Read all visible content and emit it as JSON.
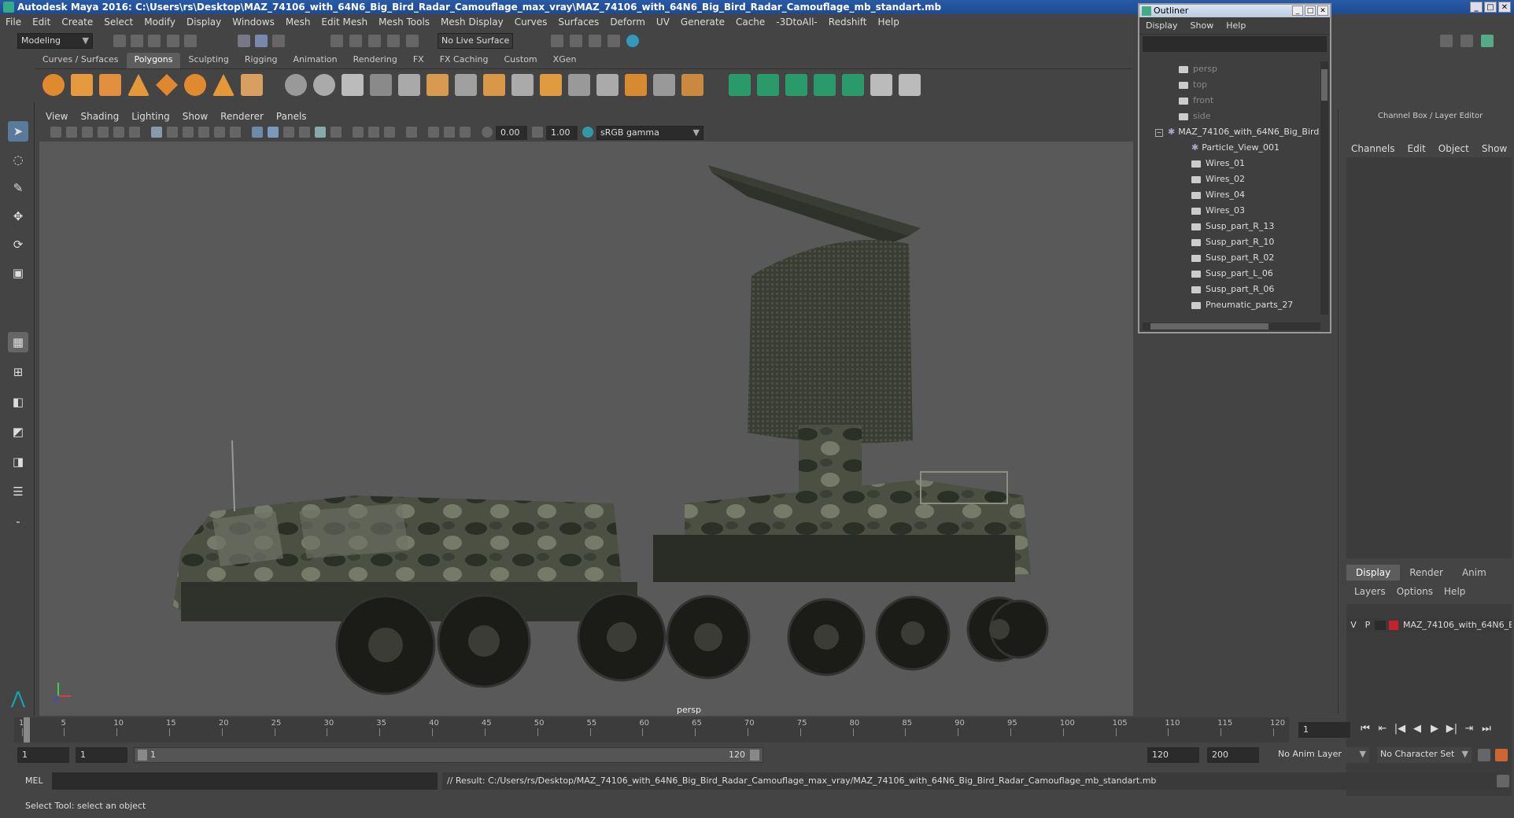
{
  "window": {
    "title": "Autodesk Maya 2016: C:\\Users\\rs\\Desktop\\MAZ_74106_with_64N6_Big_Bird_Radar_Camouflage_max_vray\\MAZ_74106_with_64N6_Big_Bird_Radar_Camouflage_mb_standart.mb"
  },
  "menubar": [
    "File",
    "Edit",
    "Create",
    "Select",
    "Modify",
    "Display",
    "Windows",
    "Mesh",
    "Edit Mesh",
    "Mesh Tools",
    "Mesh Display",
    "Curves",
    "Surfaces",
    "Deform",
    "UV",
    "Generate",
    "Cache",
    "-3DtoAll-",
    "Redshift",
    "Help"
  ],
  "statusline": {
    "mode": "Modeling",
    "live_surface": "No Live Surface"
  },
  "shelf_tabs": [
    "Curves / Surfaces",
    "Polygons",
    "Sculpting",
    "Rigging",
    "Animation",
    "Rendering",
    "FX",
    "FX Caching",
    "Custom",
    "XGen"
  ],
  "shelf_active_tab": "Polygons",
  "viewport": {
    "menu": [
      "View",
      "Shading",
      "Lighting",
      "Show",
      "Renderer",
      "Panels"
    ],
    "exposure": "0.00",
    "gamma": "1.00",
    "color_space": "sRGB gamma",
    "camera_label": "persp"
  },
  "outliner": {
    "title": "Outliner",
    "menu": [
      "Display",
      "Show",
      "Help"
    ],
    "items": [
      {
        "label": "persp",
        "icon": "camera-icon",
        "dim": true
      },
      {
        "label": "top",
        "icon": "camera-icon",
        "dim": true
      },
      {
        "label": "front",
        "icon": "camera-icon",
        "dim": true
      },
      {
        "label": "side",
        "icon": "camera-icon",
        "dim": true
      },
      {
        "label": "MAZ_74106_with_64N6_Big_Bird_",
        "icon": "group-icon",
        "dim": false
      },
      {
        "label": "Particle_View_001",
        "icon": "particle-icon",
        "dim": false
      },
      {
        "label": "Wires_01",
        "icon": "mesh-icon",
        "dim": false
      },
      {
        "label": "Wires_02",
        "icon": "mesh-icon",
        "dim": false
      },
      {
        "label": "Wires_04",
        "icon": "mesh-icon",
        "dim": false
      },
      {
        "label": "Wires_03",
        "icon": "mesh-icon",
        "dim": false
      },
      {
        "label": "Susp_part_R_13",
        "icon": "mesh-icon",
        "dim": false
      },
      {
        "label": "Susp_part_R_10",
        "icon": "mesh-icon",
        "dim": false
      },
      {
        "label": "Susp_part_R_02",
        "icon": "mesh-icon",
        "dim": false
      },
      {
        "label": "Susp_part_L_06",
        "icon": "mesh-icon",
        "dim": false
      },
      {
        "label": "Susp_part_R_06",
        "icon": "mesh-icon",
        "dim": false
      },
      {
        "label": "Pneumatic_parts_27",
        "icon": "mesh-icon",
        "dim": false
      }
    ]
  },
  "channelbox": {
    "header": "Channel Box / Layer Editor",
    "menu": [
      "Channels",
      "Edit",
      "Object",
      "Show"
    ],
    "tabs": [
      "Display",
      "Render",
      "Anim"
    ],
    "active_tab": "Display",
    "layer_menu": [
      "Layers",
      "Options",
      "Help"
    ],
    "layer": {
      "v": "V",
      "p": "P",
      "name": "MAZ_74106_with_64N6_B",
      "color": "#c8202c"
    }
  },
  "timeline": {
    "ticks": [
      "1",
      "5",
      "10",
      "15",
      "20",
      "25",
      "30",
      "35",
      "40",
      "45",
      "50",
      "55",
      "60",
      "65",
      "70",
      "75",
      "80",
      "85",
      "90",
      "95",
      "100",
      "105",
      "110",
      "115",
      "120"
    ],
    "current_frame": "1"
  },
  "range": {
    "start": "1",
    "start_inner": "1",
    "slider_start": "1",
    "slider_end": "120",
    "end_inner": "120",
    "end": "200",
    "anim_layer": "No Anim Layer",
    "character_set": "No Character Set"
  },
  "command": {
    "lang": "MEL",
    "result": "// Result: C:/Users/rs/Desktop/MAZ_74106_with_64N6_Big_Bird_Radar_Camouflage_max_vray/MAZ_74106_with_64N6_Big_Bird_Radar_Camouflage_mb_standart.mb"
  },
  "helpline": "Select Tool: select an object"
}
